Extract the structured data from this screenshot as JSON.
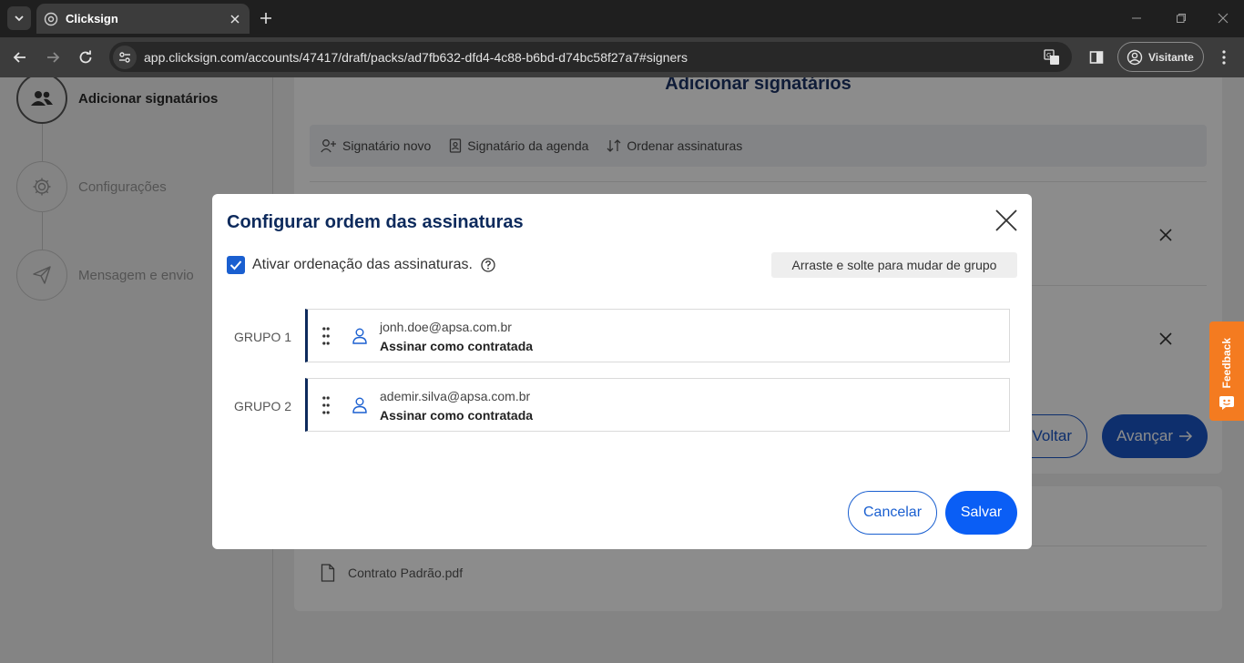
{
  "browser": {
    "tab_title": "Clicksign",
    "url": "app.clicksign.com/accounts/47417/draft/packs/ad7fb632-dfd4-4c88-b6bd-d74bc58f27a7#signers",
    "profile_label": "Visitante"
  },
  "sidebar": {
    "steps": [
      {
        "label": "Adicionar signatários",
        "icon": "users-icon",
        "active": true
      },
      {
        "label": "Configurações",
        "icon": "gear-icon",
        "active": false
      },
      {
        "label": "Mensagem e envio",
        "icon": "paper-plane-icon",
        "active": false
      }
    ]
  },
  "main": {
    "title": "Adicionar signatários",
    "actions": [
      {
        "label": "Signatário novo",
        "icon": "add-user-icon"
      },
      {
        "label": "Signatário da agenda",
        "icon": "contact-book-icon"
      },
      {
        "label": "Ordenar assinaturas",
        "icon": "sort-icon"
      }
    ],
    "back_label": "Voltar",
    "next_label": "Avançar",
    "document_name": "Contrato Padrão.pdf"
  },
  "feedback": {
    "label": "Feedback"
  },
  "modal": {
    "title": "Configurar ordem das assinaturas",
    "checkbox_label": "Ativar ordenação das assinaturas.",
    "checkbox_checked": true,
    "hint": "Arraste e solte para mudar de grupo",
    "groups": [
      {
        "label": "GRUPO 1",
        "email": "jonh.doe@apsa.com.br",
        "role": "Assinar como contratada"
      },
      {
        "label": "GRUPO 2",
        "email": "ademir.silva@apsa.com.br",
        "role": "Assinar como contratada"
      }
    ],
    "cancel_label": "Cancelar",
    "save_label": "Salvar"
  },
  "colors": {
    "primary": "#0a5ef5",
    "navy": "#0d2a5c",
    "feedback": "#f47b20"
  }
}
